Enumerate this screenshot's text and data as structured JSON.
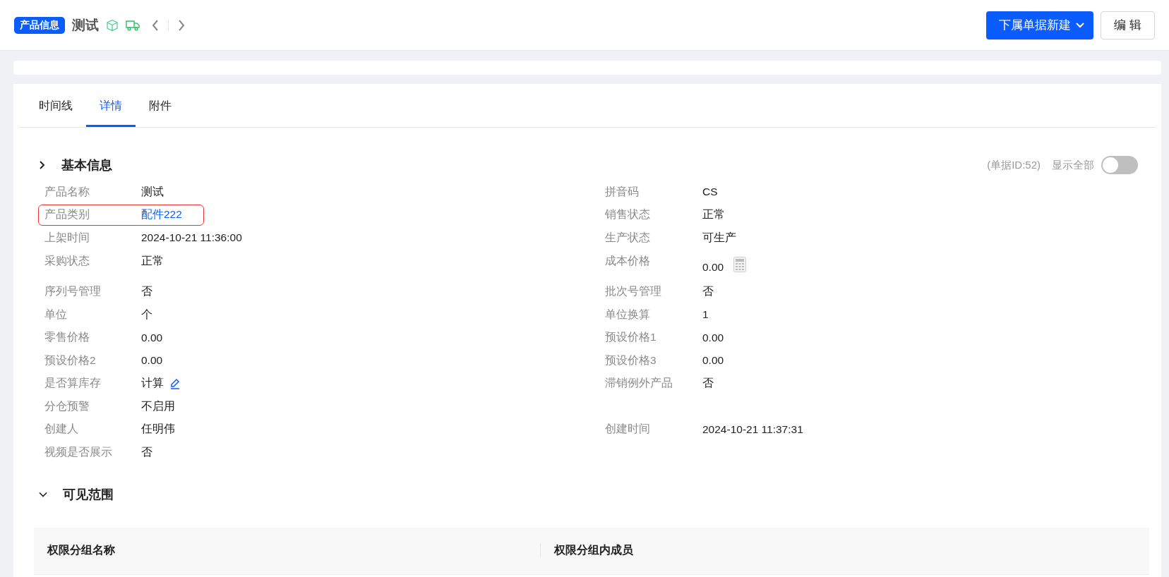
{
  "header": {
    "badge": "产品信息",
    "title": "测试",
    "new_button": "下属单据新建",
    "edit_button": "编 辑"
  },
  "tabs": [
    {
      "label": "时间线",
      "selected": false
    },
    {
      "label": "详情",
      "selected": true
    },
    {
      "label": "附件",
      "selected": false
    }
  ],
  "basic_info": {
    "title": "基本信息",
    "expanded": false,
    "doc_id": "(单据ID:52)",
    "show_all": {
      "label": "显示全部",
      "on": false
    },
    "rows": [
      {
        "left": {
          "label": "产品名称",
          "value": "测试",
          "kind": "text",
          "highlighted": false
        },
        "right": {
          "label": "拼音码",
          "value": "CS",
          "kind": "text"
        }
      },
      {
        "left": {
          "label": "产品类别",
          "value": "配件222",
          "kind": "link",
          "highlighted": true
        },
        "right": {
          "label": "销售状态",
          "value": "正常",
          "kind": "text"
        }
      },
      {
        "left": {
          "label": "上架时间",
          "value": "2024-10-21 11:36:00",
          "kind": "text",
          "highlighted": false
        },
        "right": {
          "label": "生产状态",
          "value": "可生产",
          "kind": "text"
        }
      },
      {
        "left": {
          "label": "采购状态",
          "value": "正常",
          "kind": "text",
          "highlighted": false
        },
        "right": {
          "label": "成本价格",
          "value": "0.00",
          "kind": "calculator"
        }
      },
      {
        "left": {
          "label": "序列号管理",
          "value": "否",
          "kind": "text",
          "highlighted": false
        },
        "right": {
          "label": "批次号管理",
          "value": "否",
          "kind": "text"
        }
      },
      {
        "left": {
          "label": "单位",
          "value": "个",
          "kind": "text",
          "highlighted": false
        },
        "right": {
          "label": "单位换算",
          "value": "1",
          "kind": "text"
        }
      },
      {
        "left": {
          "label": "零售价格",
          "value": "0.00",
          "kind": "text",
          "highlighted": false
        },
        "right": {
          "label": "预设价格1",
          "value": "0.00",
          "kind": "text"
        }
      },
      {
        "left": {
          "label": "预设价格2",
          "value": "0.00",
          "kind": "text",
          "highlighted": false
        },
        "right": {
          "label": "预设价格3",
          "value": "0.00",
          "kind": "text"
        }
      },
      {
        "left": {
          "label": "是否算库存",
          "value": "计算",
          "kind": "editable",
          "highlighted": false
        },
        "right": {
          "label": "滞销例外产品",
          "value": "否",
          "kind": "text"
        }
      },
      {
        "left": {
          "label": "分仓预警",
          "value": "不启用",
          "kind": "text",
          "highlighted": false
        }
      },
      {
        "left": {
          "label": "创建人",
          "value": "任明伟",
          "kind": "text",
          "highlighted": false
        },
        "right": {
          "label": "创建时间",
          "value": "2024-10-21 11:37:31",
          "kind": "text"
        }
      },
      {
        "left": {
          "label": "视频是否展示",
          "value": "否",
          "kind": "text",
          "highlighted": false
        }
      }
    ]
  },
  "visibility": {
    "title": "可见范围",
    "expanded": true,
    "columns": [
      "权限分组名称",
      "权限分组内成员"
    ]
  }
}
